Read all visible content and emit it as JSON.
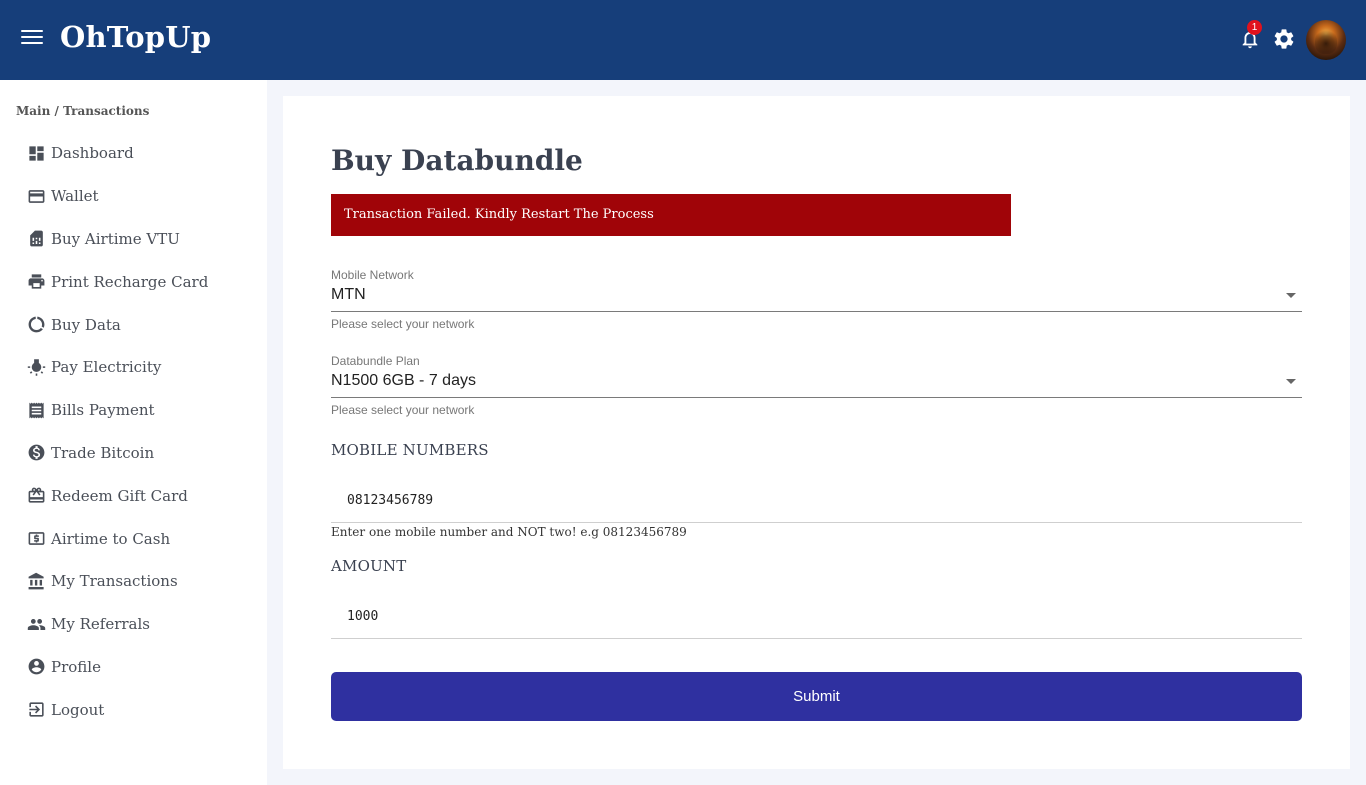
{
  "header": {
    "brand": "OhTopUp",
    "notification_count": "1",
    "icons": [
      "menu-icon",
      "bell-icon",
      "gear-icon",
      "avatar"
    ]
  },
  "sidebar": {
    "breadcrumb": "Main / Transactions",
    "items": [
      {
        "label": "Dashboard",
        "icon": "dashboard-icon"
      },
      {
        "label": "Wallet",
        "icon": "credit-card-icon"
      },
      {
        "label": "Buy Airtime VTU",
        "icon": "sim-card-icon"
      },
      {
        "label": "Print Recharge Card",
        "icon": "printer-icon"
      },
      {
        "label": "Buy Data",
        "icon": "data-usage-icon"
      },
      {
        "label": "Pay Electricity",
        "icon": "light-bulb-icon"
      },
      {
        "label": "Bills Payment",
        "icon": "receipt-icon"
      },
      {
        "label": "Trade Bitcoin",
        "icon": "dollar-circle-icon"
      },
      {
        "label": "Redeem Gift Card",
        "icon": "gift-card-icon"
      },
      {
        "label": "Airtime to Cash",
        "icon": "cash-icon"
      },
      {
        "label": "My Transactions",
        "icon": "bank-icon"
      },
      {
        "label": "My Referrals",
        "icon": "people-icon"
      },
      {
        "label": "Profile",
        "icon": "account-circle-icon"
      },
      {
        "label": "Logout",
        "icon": "logout-icon"
      }
    ]
  },
  "main": {
    "title": "Buy Databundle",
    "alert": "Transaction Failed. Kindly Restart The Process",
    "network": {
      "label": "Mobile Network",
      "value": "MTN",
      "helper": "Please select your network"
    },
    "plan": {
      "label": "Databundle Plan",
      "value": "N1500 6GB - 7 days",
      "helper": "Please select your network"
    },
    "mobile": {
      "heading": "MOBILE NUMBERS",
      "value": "08123456789",
      "note": "Enter one mobile number and NOT two! e.g 08123456789"
    },
    "amount": {
      "heading": "AMOUNT",
      "value": "1000"
    },
    "submit_label": "Submit"
  },
  "colors": {
    "header_bg": "#163e7a",
    "alert_bg": "#a00408",
    "submit_bg": "#2f30a0"
  }
}
